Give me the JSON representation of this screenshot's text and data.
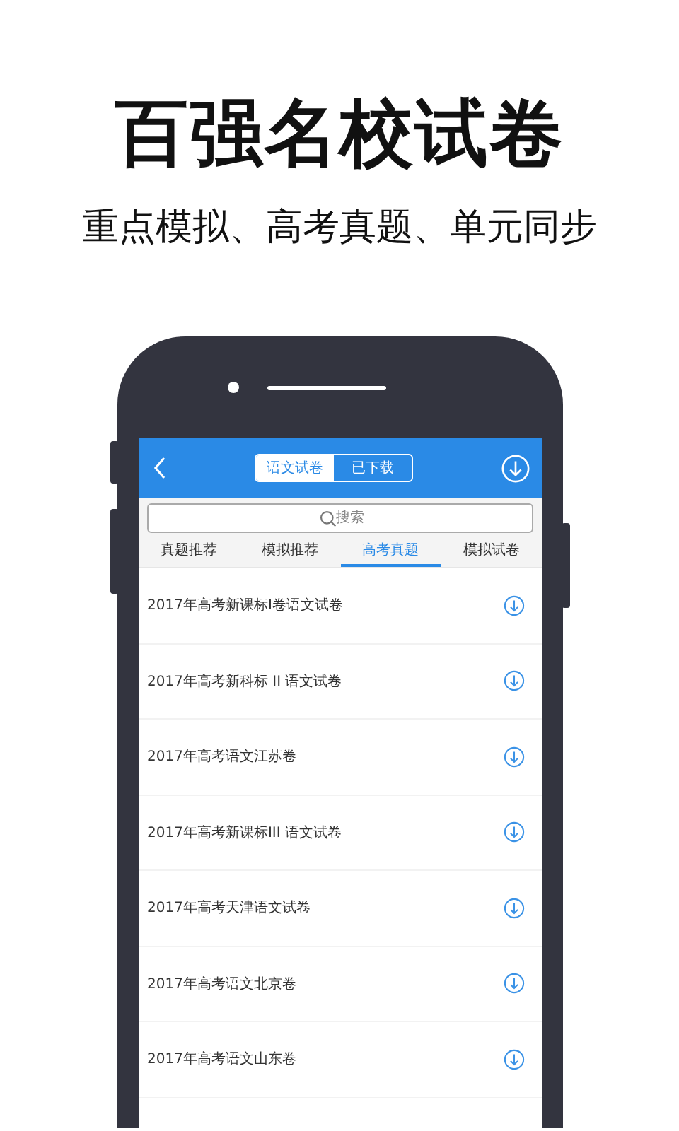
{
  "headline": "百强名校试卷",
  "subheadline": "重点模拟、高考真题、单元同步",
  "app": {
    "segments": [
      {
        "label": "语文试卷",
        "selected": true
      },
      {
        "label": "已下载",
        "selected": false
      }
    ],
    "search": {
      "placeholder": "搜索"
    },
    "tabs": [
      {
        "label": "真题推荐",
        "selected": false
      },
      {
        "label": "模拟推荐",
        "selected": false
      },
      {
        "label": "高考真题",
        "selected": true
      },
      {
        "label": "模拟试卷",
        "selected": false
      }
    ],
    "papers": [
      {
        "title": "2017年高考新课标I卷语文试卷"
      },
      {
        "title": "2017年高考新科标 II 语文试卷"
      },
      {
        "title": "2017年高考语文江苏卷"
      },
      {
        "title": "2017年高考新课标III 语文试卷"
      },
      {
        "title": "2017年高考天津语文试卷"
      },
      {
        "title": "2017年高考语文北京卷"
      },
      {
        "title": "2017年高考语文山东卷"
      }
    ]
  }
}
